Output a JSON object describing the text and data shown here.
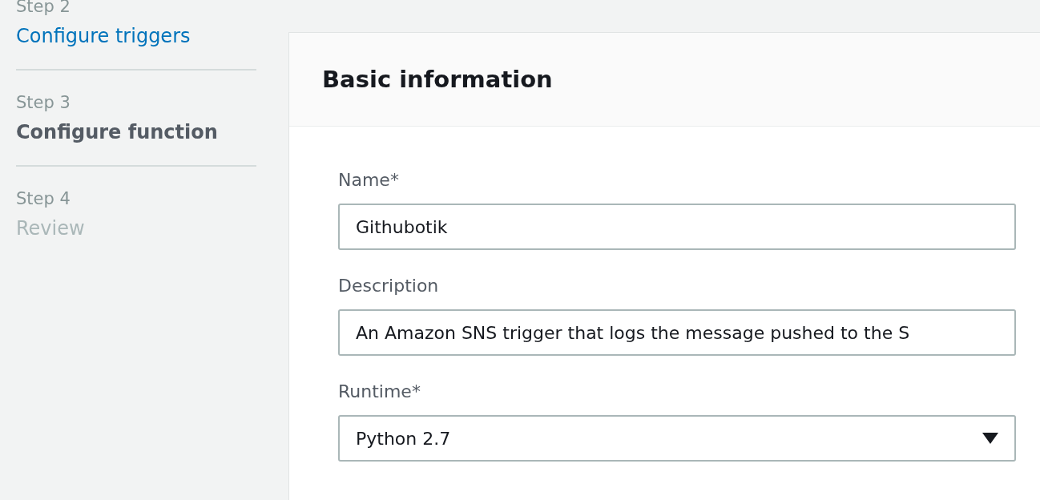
{
  "steps": [
    {
      "step": "Step 2",
      "title": "Configure triggers",
      "kind": "done"
    },
    {
      "step": "Step 3",
      "title": "Configure function",
      "kind": "current"
    },
    {
      "step": "Step 4",
      "title": "Review",
      "kind": "upcoming"
    }
  ],
  "panel": {
    "title": "Basic information",
    "fields": [
      {
        "label": "Name*",
        "kind": "text",
        "value": "Githubotik"
      },
      {
        "label": "Description",
        "kind": "text",
        "value": "An Amazon SNS trigger that logs the message pushed to the S"
      },
      {
        "label": "Runtime*",
        "kind": "select",
        "value": "Python 2.7"
      }
    ]
  }
}
